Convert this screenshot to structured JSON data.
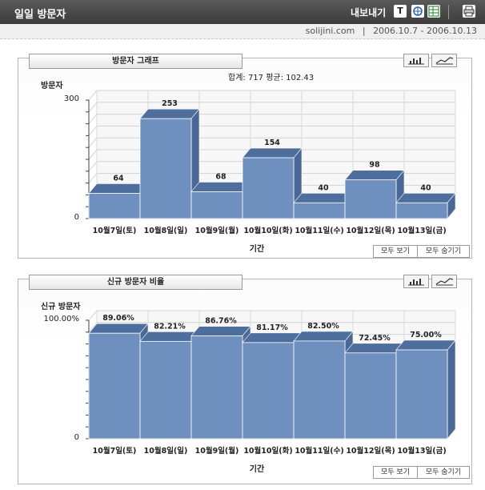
{
  "header": {
    "title": "일일 방문자",
    "export_label": "내보내기"
  },
  "subheader": {
    "site": "solijini.com",
    "separator": "|",
    "period": "2006.10.7 - 2006.10.13"
  },
  "icons": [
    "text-export-icon",
    "web-export-icon",
    "excel-export-icon",
    "print-icon"
  ],
  "visitor_panel": {
    "title": "방문자 그래프",
    "y_title": "방문자",
    "summary": "합계: 717   평균: 102.43",
    "x_title": "기간",
    "show_all": "모두 보기",
    "hide_all": "모두 숨기기"
  },
  "new_panel": {
    "title": "신규 방문자 비율",
    "y_title": "신규 방문자",
    "x_title": "기간",
    "show_all": "모두 보기",
    "hide_all": "모두 숨기기"
  },
  "colors": {
    "bar_front": "#6f8fbf",
    "bar_top": "#4e6e9e",
    "bar_side": "#4a6894",
    "header_bg": "#4a4a4a"
  },
  "chart_data": [
    {
      "type": "bar",
      "categories": [
        "10월7일(토)",
        "10월8일(일)",
        "10월9일(월)",
        "10월10일(화)",
        "10월11일(수)",
        "10월12일(목)",
        "10월13일(금)"
      ],
      "values": [
        64,
        253,
        68,
        154,
        40,
        98,
        40
      ],
      "data_labels": [
        "64",
        "253",
        "68",
        "154",
        "40",
        "98",
        "40"
      ],
      "ylim": [
        0,
        300
      ],
      "yticks": [
        "0",
        "300"
      ],
      "ylabel": "방문자",
      "xlabel": "기간",
      "grid": true
    },
    {
      "type": "bar",
      "categories": [
        "10월7일(토)",
        "10월8일(일)",
        "10월9일(월)",
        "10월10일(화)",
        "10월11일(수)",
        "10월12일(목)",
        "10월13일(금)"
      ],
      "values": [
        89.06,
        82.21,
        86.76,
        81.17,
        82.5,
        72.45,
        75.0
      ],
      "data_labels": [
        "89.06%",
        "82.21%",
        "86.76%",
        "81.17%",
        "82.50%",
        "72.45%",
        "75.00%"
      ],
      "ylim": [
        0,
        100
      ],
      "yticks": [
        "0",
        "100.00%"
      ],
      "ylabel": "신규 방문자",
      "xlabel": "기간",
      "grid": true
    }
  ]
}
